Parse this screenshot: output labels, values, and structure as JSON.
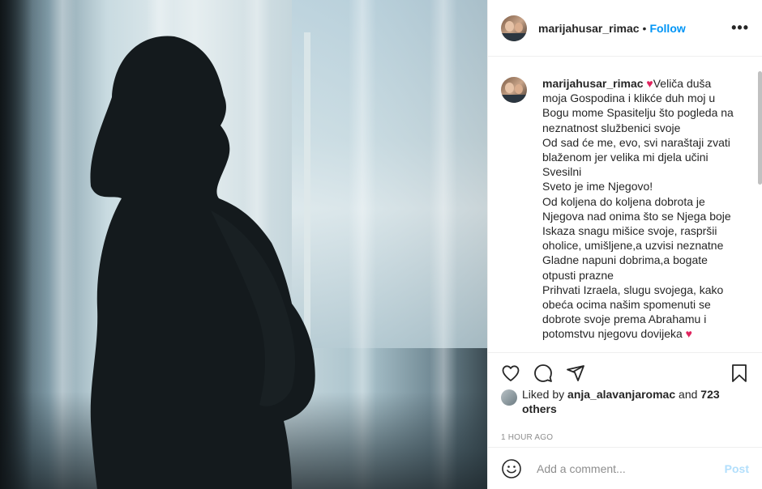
{
  "post": {
    "username": "marijahusar_rimac",
    "follow_label": "Follow",
    "separator": "•",
    "more_label": "•••"
  },
  "caption": {
    "username": "marijahusar_rimac",
    "emoji": "♥",
    "text": "Veliča duša moja Gospodina i klikće duh moj u Bogu mome Spasitelju što pogleda na neznatnost službenici svoje\nOd sad će me, evo, svi naraštaji zvati blaženom jer velika mi djela učini Svesilni\nSveto je ime Njegovo!\nOd koljena do koljena dobrota je Njegova nad onima što se Njega boje\nIskaza snagu mišice svoje, raspršii oholice, umišljene,a uzvisi neznatne\nGladne napuni dobrima,a bogate otpusti prazne\nPrihvati Izraela, slugu svojega, kako obeća ocima našim spomenuti se dobrote svoje prema Abrahamu i potomstvu njegovu dovijeka",
    "end_emoji": "♥"
  },
  "likes": {
    "prefix": "Liked by ",
    "user": "anja_alavanjaromac",
    "middle": " and ",
    "others": "723 others"
  },
  "timestamp": "1 HOUR AGO",
  "comment": {
    "placeholder": "Add a comment...",
    "post_label": "Post"
  },
  "colors": {
    "accent": "#0095f6",
    "post_disabled": "#b2dffc",
    "heart": "#e0245e"
  },
  "icons": [
    "heart-icon",
    "comment-icon",
    "share-icon",
    "bookmark-icon",
    "emoji-icon",
    "more-icon"
  ]
}
